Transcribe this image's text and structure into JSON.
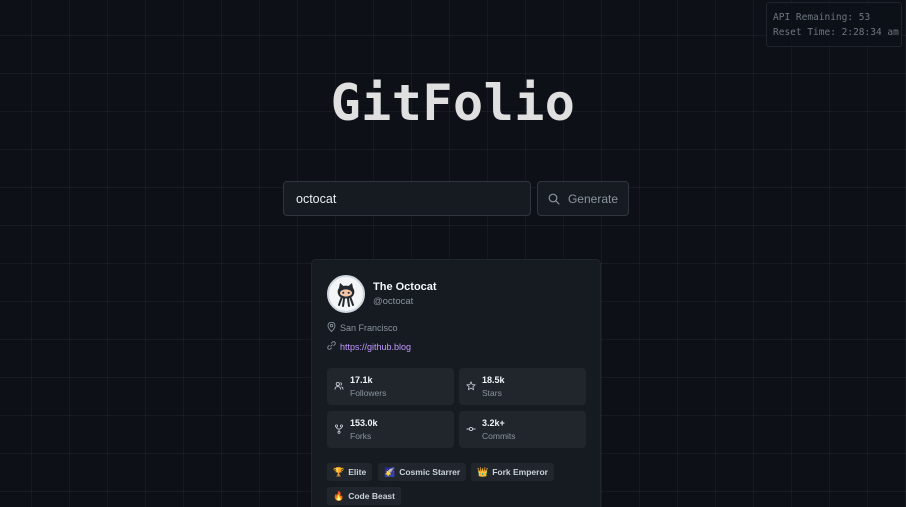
{
  "api": {
    "remaining_label": "API Remaining: 53",
    "reset_label": "Reset Time: 2:28:34 am"
  },
  "app_title": "GitFolio",
  "search": {
    "value": "octocat",
    "button_label": "Generate"
  },
  "profile": {
    "name": "The Octocat",
    "login": "@octocat",
    "location": "San Francisco",
    "blog": "https://github.blog",
    "stats": [
      {
        "value": "17.1k",
        "label": "Followers",
        "icon": "users-icon"
      },
      {
        "value": "18.5k",
        "label": "Stars",
        "icon": "star-icon"
      },
      {
        "value": "153.0k",
        "label": "Forks",
        "icon": "fork-icon"
      },
      {
        "value": "3.2k+",
        "label": "Commits",
        "icon": "commit-icon"
      }
    ],
    "badges": [
      {
        "emoji": "🏆",
        "label": "Elite"
      },
      {
        "emoji": "🌠",
        "label": "Cosmic Starrer"
      },
      {
        "emoji": "👑",
        "label": "Fork Emperor"
      },
      {
        "emoji": "🔥",
        "label": "Code Beast"
      }
    ]
  },
  "colors": {
    "background": "#0d1117",
    "card": "#161b22",
    "link": "#c297ff"
  }
}
